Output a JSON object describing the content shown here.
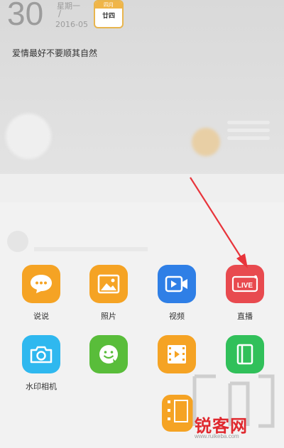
{
  "header": {
    "day_number": "30",
    "weekday": "星期一",
    "slash": "/",
    "year_month": "2016-05",
    "calendar_badge": {
      "month": "四月",
      "day": "廿四"
    },
    "motto": "爱情最好不要顺其自然"
  },
  "apps": [
    {
      "label": "说说",
      "icon": "chat-bubble-icon",
      "color": "#f5a324"
    },
    {
      "label": "照片",
      "icon": "photo-icon",
      "color": "#f5a324"
    },
    {
      "label": "视频",
      "icon": "video-camera-icon",
      "color": "#2f7fe6"
    },
    {
      "label": "直播",
      "icon": "live-tv-icon",
      "color": "#e84a4f"
    },
    {
      "label": "水印相机",
      "icon": "camera-icon",
      "color": "#2fb8ef"
    },
    {
      "label": "",
      "icon": "smiley-icon",
      "color": "#59bd3a"
    },
    {
      "label": "",
      "icon": "film-icon",
      "color": "#f5a324"
    },
    {
      "label": "",
      "icon": "notebook-icon",
      "color": "#31c05a"
    }
  ],
  "live_badge_text": "LIVE",
  "watermark": {
    "brand": "锐客网",
    "url": "www.ruikeba.com"
  },
  "colors": {
    "arrow": "#e8343b"
  }
}
